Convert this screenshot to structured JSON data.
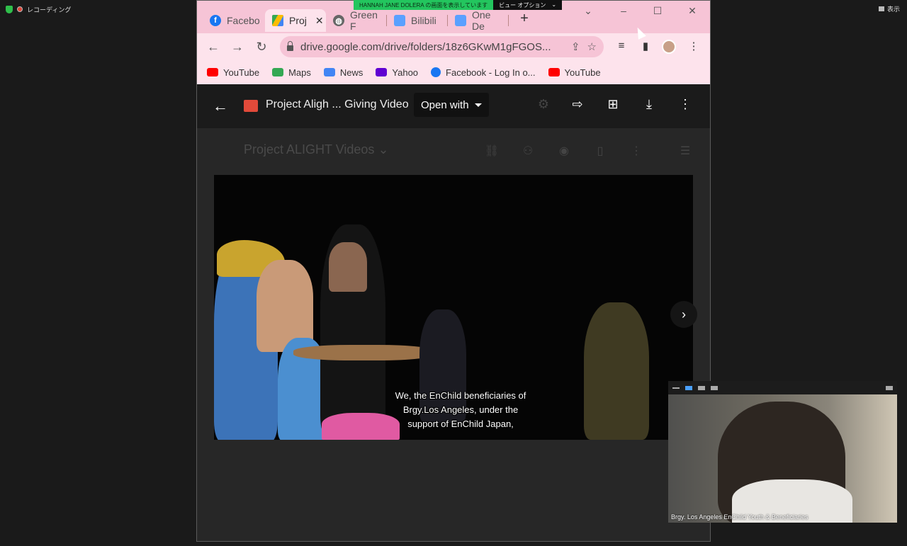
{
  "zoom": {
    "recording_label": "レコーディング",
    "view_label": "表示",
    "share_banner": "HANNAH JANE DOLERA の画面を表示しています",
    "view_options": "ビュー オプション"
  },
  "browser": {
    "tabs": [
      {
        "label": "Facebo",
        "icon": "facebook-icon",
        "color": "#1877f2"
      },
      {
        "label": "Proj",
        "icon": "google-drive-icon",
        "color": "#f4b400"
      },
      {
        "label": "Green F",
        "icon": "globe-icon",
        "color": "#666666"
      },
      {
        "label": "Bilibili",
        "icon": "bilibili-icon",
        "color": "#5aa0ff"
      },
      {
        "label": "One De",
        "icon": "bilibili-icon",
        "color": "#5aa0ff"
      }
    ],
    "url": "drive.google.com/drive/folders/18z6GKwM1gFGOS...",
    "bookmarks": [
      {
        "label": "YouTube",
        "icon": "youtube-icon",
        "color": "#ff0000"
      },
      {
        "label": "Maps",
        "icon": "maps-icon",
        "color": "#34a853"
      },
      {
        "label": "News",
        "icon": "news-icon",
        "color": "#4285f4"
      },
      {
        "label": "Yahoo",
        "icon": "yahoo-icon",
        "color": "#6001d2"
      },
      {
        "label": "Facebook - Log In o...",
        "icon": "facebook-icon",
        "color": "#1877f2"
      },
      {
        "label": "YouTube",
        "icon": "youtube-icon",
        "color": "#ff0000"
      }
    ]
  },
  "drive": {
    "file_title": "Project Aligh ... Giving Video",
    "open_with": "Open with",
    "folder_name": "Project ALIGHT Videos",
    "subtitles": [
      "We, the EnChild beneficiaries of",
      "Brgy.Los Angeles, under the",
      "support of EnChild Japan,"
    ]
  },
  "self_view": {
    "name": "Brgy. Los Angeles EnChild Youth & Beneficiaries"
  }
}
